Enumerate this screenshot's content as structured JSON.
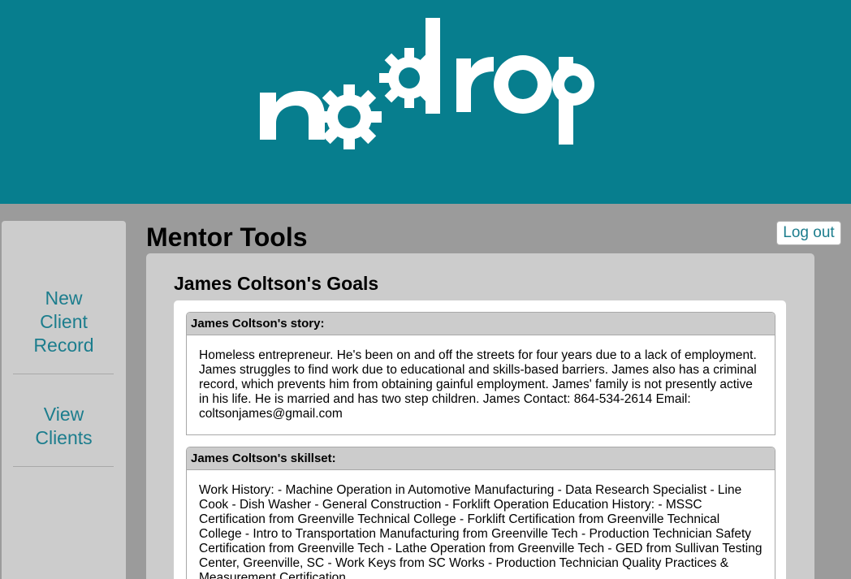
{
  "header": {
    "logo_text": "nodrop",
    "brand_color": "#077e8e"
  },
  "sidebar": {
    "items": [
      {
        "label_lines": [
          "New",
          "Client",
          "Record"
        ]
      },
      {
        "label_lines": [
          "View",
          "Clients"
        ]
      }
    ]
  },
  "page": {
    "title": "Mentor Tools",
    "logout_label": "Log out"
  },
  "goals": {
    "title": "James Coltson's Goals",
    "story": {
      "heading": "James Coltson's story:",
      "text": "Homeless entrepreneur. He's been on and off the streets for four years due to a lack of employment. James struggles to find work due to educational and skills-based barriers. James also has a criminal record, which prevents him from obtaining gainful employment. James' family is not presently active in his life. He is married and has two step children. James Contact: 864-534-2614 Email: coltsonjames@gmail.com"
    },
    "skillset": {
      "heading": "James Coltson's skillset:",
      "text": "Work History: - Machine Operation in Automotive Manufacturing - Data Research Specialist - Line Cook - Dish Washer - General Construction - Forklift Operation Education History: - MSSC Certification from Greenville Technical College - Forklift Certification from Greenville Technical College - Intro to Transportation Manufacturing from Greenville Tech - Production Technician Safety Certification from Greenville Tech - Lathe Operation from Greenville Tech - GED from Sullivan Testing Center, Greenville, SC - Work Keys from SC Works - Production Technician Quality Practices & Measurement Certification"
    }
  }
}
